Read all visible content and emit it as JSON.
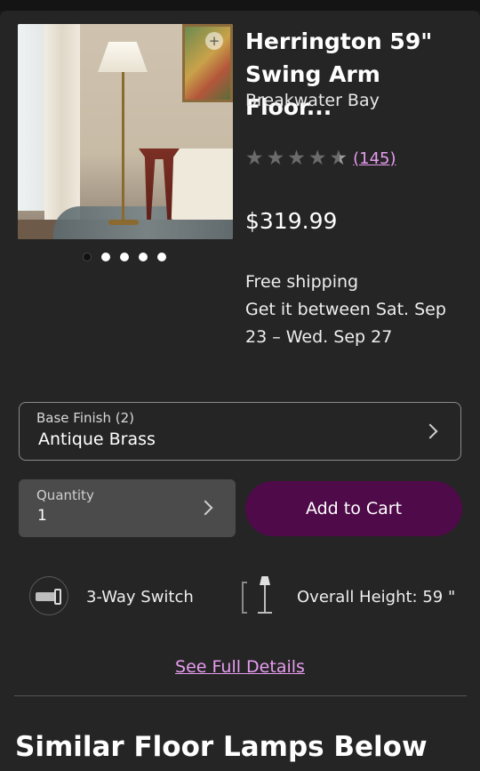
{
  "product": {
    "title_line1": "Herrington 59\"",
    "title_line2": "Swing Arm Floor...",
    "brand": "Breakwater Bay",
    "rating": 4.5,
    "rating_max": 5,
    "review_count": "(145)",
    "price": "$319.99",
    "shipping": {
      "line1": "Free shipping",
      "line2": "Get it between Sat. Sep",
      "line3": "23 – Wed. Sep 27"
    }
  },
  "gallery": {
    "image_count": 5,
    "active_index": 0,
    "zoom_icon": "zoom-plus-icon"
  },
  "options": {
    "base_finish_label": "Base Finish (2)",
    "base_finish_value": "Antique Brass",
    "quantity_label": "Quantity",
    "quantity_value": "1",
    "add_to_cart_label": "Add to Cart"
  },
  "features": [
    {
      "icon": "switch-icon",
      "text": "3-Way Switch"
    },
    {
      "icon": "lamp-height-icon",
      "text": "Overall Height: 59 \""
    }
  ],
  "links": {
    "see_full_details": "See Full Details"
  },
  "sections": {
    "similar_title": "Similar Floor Lamps Below"
  },
  "colors": {
    "background": "#252525",
    "accent_link": "#e79cf0",
    "cart_button": "#4f0b49",
    "quantity_box": "#4b4b4b"
  }
}
